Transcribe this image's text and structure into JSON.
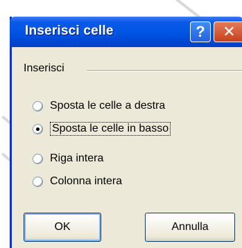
{
  "dialog": {
    "title": "Inserisci celle",
    "help_glyph": "?",
    "close_glyph": "✕"
  },
  "group": {
    "label": "Inserisci",
    "options": [
      {
        "label": "Sposta le celle a destra",
        "checked": false
      },
      {
        "label": "Sposta le celle in basso",
        "checked": true
      },
      {
        "label": "Riga intera",
        "checked": false
      },
      {
        "label": "Colonna intera",
        "checked": false
      }
    ]
  },
  "buttons": {
    "ok_label": "OK",
    "cancel_label": "Annulla"
  },
  "colors": {
    "titlebar": "#0054e3",
    "dialog_bg": "#ece9d8",
    "close_button": "#c7411b"
  }
}
